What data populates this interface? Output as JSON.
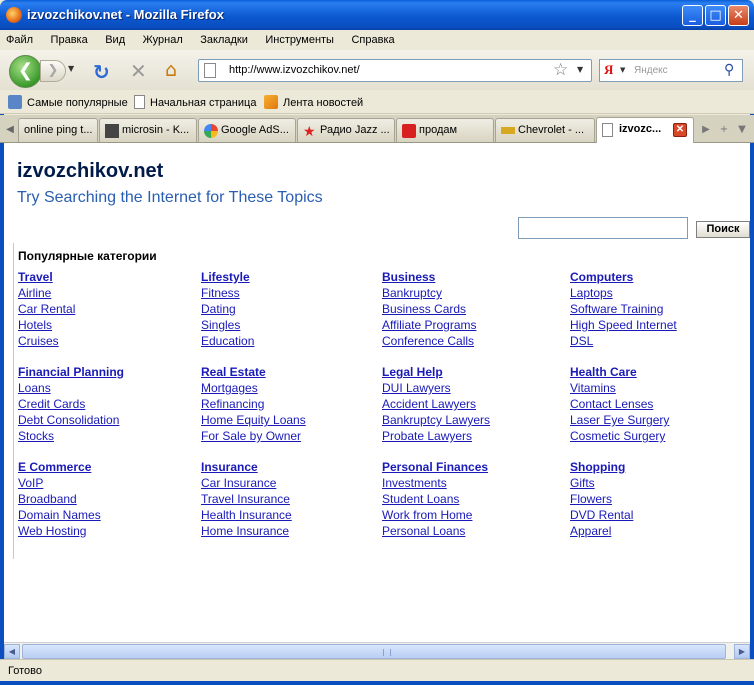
{
  "window": {
    "title": "izvozchikov.net - Mozilla Firefox"
  },
  "menu": [
    "Файл",
    "Правка",
    "Вид",
    "Журнал",
    "Закладки",
    "Инструменты",
    "Справка"
  ],
  "nav": {
    "url": "http://www.izvozchikov.net/",
    "search_engine_label": "Я",
    "search_placeholder": "Яндекс"
  },
  "bookmarks": [
    "Самые популярные",
    "Начальная страница",
    "Лента новостей"
  ],
  "tabs": [
    {
      "label": "online ping t...",
      "active": false
    },
    {
      "label": "microsin - K...",
      "active": false
    },
    {
      "label": "Google AdS...",
      "active": false
    },
    {
      "label": "Радио Jazz ...",
      "active": false
    },
    {
      "label": "продам",
      "active": false
    },
    {
      "label": "Chevrolet - ...",
      "active": false
    },
    {
      "label": "izvozc...",
      "active": true
    }
  ],
  "page": {
    "site_title": "izvozchikov.net",
    "subtitle": "Try Searching the Internet for These Topics",
    "search_button": "Поиск",
    "popular_label": "Популярные категории",
    "categories": [
      {
        "title": "Travel",
        "links": [
          "Airline",
          "Car Rental",
          "Hotels",
          "Cruises"
        ]
      },
      {
        "title": "Lifestyle",
        "links": [
          "Fitness",
          "Dating",
          "Singles",
          "Education"
        ]
      },
      {
        "title": "Business",
        "links": [
          "Bankruptcy",
          "Business Cards",
          "Affiliate Programs",
          "Conference Calls"
        ]
      },
      {
        "title": "Computers",
        "links": [
          "Laptops",
          "Software Training",
          "High Speed Internet",
          "DSL"
        ]
      },
      {
        "title": "Financial Planning",
        "links": [
          "Loans",
          "Credit Cards",
          "Debt Consolidation",
          "Stocks"
        ]
      },
      {
        "title": "Real Estate",
        "links": [
          "Mortgages",
          "Refinancing",
          "Home Equity Loans",
          "For Sale by Owner"
        ]
      },
      {
        "title": "Legal Help",
        "links": [
          "DUI Lawyers",
          "Accident Lawyers",
          "Bankruptcy Lawyers",
          "Probate Lawyers"
        ]
      },
      {
        "title": "Health Care",
        "links": [
          "Vitamins",
          "Contact Lenses",
          "Laser Eye Surgery",
          "Cosmetic Surgery"
        ]
      },
      {
        "title": "E Commerce",
        "links": [
          "VoIP",
          "Broadband",
          "Domain Names",
          "Web Hosting"
        ]
      },
      {
        "title": "Insurance",
        "links": [
          "Car Insurance",
          "Travel Insurance",
          "Health Insurance",
          "Home Insurance"
        ]
      },
      {
        "title": "Personal Finances",
        "links": [
          "Investments",
          "Student Loans",
          "Work from Home",
          "Personal Loans"
        ]
      },
      {
        "title": "Shopping",
        "links": [
          "Gifts",
          "Flowers",
          "DVD Rental",
          "Apparel"
        ]
      }
    ]
  },
  "status": {
    "text": "Готово"
  },
  "colors": {
    "link": "#1a1ab8",
    "subtitle": "#2a5eb0",
    "titlebar": "#0a5fd8"
  }
}
